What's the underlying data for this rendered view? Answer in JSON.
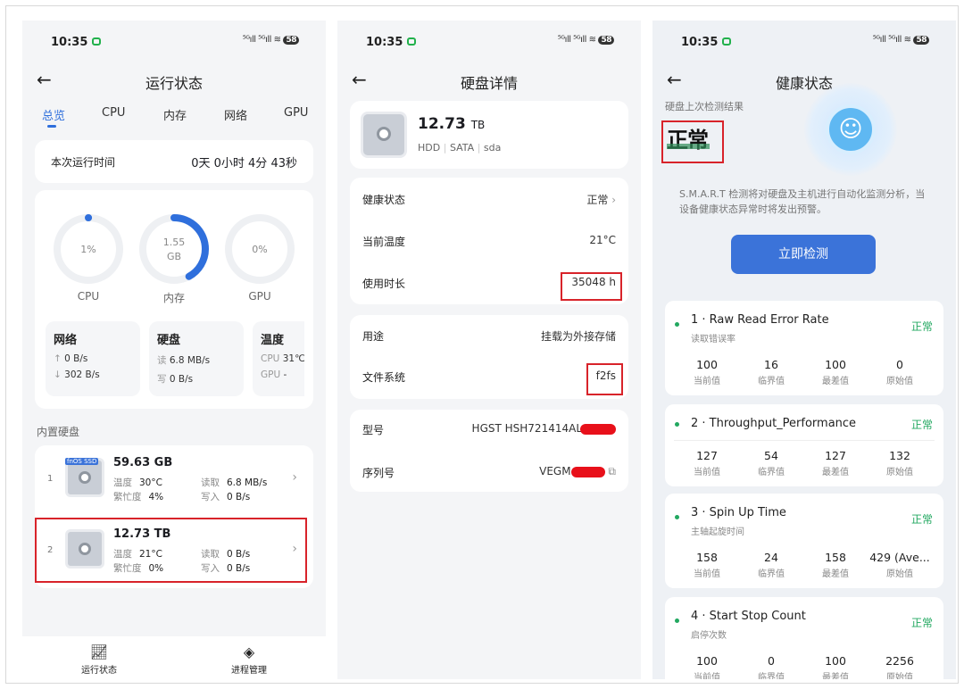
{
  "status": {
    "time": "10:35",
    "signal": "⁵ᴳıll ⁵ᴳıll ≋",
    "battery": "58"
  },
  "colors": {
    "accent": "#2f6fdc",
    "ok_green": "#22a860",
    "highlight_red": "#d8232a",
    "button": "#3b73d9"
  },
  "panel1": {
    "title": "运行状态",
    "tabs": [
      "总览",
      "CPU",
      "内存",
      "网络",
      "GPU"
    ],
    "uptime": {
      "label": "本次运行时间",
      "value": "0天 0小时 4分 43秒"
    },
    "rings": [
      {
        "label": "CPU",
        "text": "1%",
        "fraction": 0.01
      },
      {
        "label": "内存",
        "text": "1.55",
        "text2": "GB",
        "fraction": 0.42
      },
      {
        "label": "GPU",
        "text": "0%",
        "fraction": 0
      }
    ],
    "mini": [
      {
        "title": "网络",
        "l1k": "↑",
        "l1v": "0 B/s",
        "l2k": "↓",
        "l2v": "302 B/s"
      },
      {
        "title": "硬盘",
        "l1k": "读",
        "l1v": "6.8 MB/s",
        "l2k": "写",
        "l2v": "0 B/s"
      },
      {
        "title": "温度",
        "l1k": "CPU",
        "l1v": "31℃",
        "l2k": "GPU",
        "l2v": "-"
      }
    ],
    "disks_title": "内置硬盘",
    "disks": [
      {
        "num": "1",
        "size": "59.63 GB",
        "badge": "fnOS SSD",
        "temp_k": "温度",
        "temp": "30°C",
        "busy_k": "繁忙度",
        "busy": "4%",
        "read_k": "读取",
        "read": "6.8 MB/s",
        "write_k": "写入",
        "write": "0 B/s"
      },
      {
        "num": "2",
        "size": "12.73 TB",
        "temp_k": "温度",
        "temp": "21°C",
        "busy_k": "繁忙度",
        "busy": "0%",
        "read_k": "读取",
        "read": "0 B/s",
        "write_k": "写入",
        "write": "0 B/s"
      }
    ],
    "nav": [
      "运行状态",
      "进程管理"
    ]
  },
  "panel2": {
    "title": "硬盘详情",
    "size_num": "12.73",
    "size_unit": "TB",
    "type": "HDD",
    "iface": "SATA",
    "dev": "sda",
    "health_label": "健康状态",
    "health_value": "正常",
    "temp_label": "当前温度",
    "temp_value": "21°C",
    "hours_label": "使用时长",
    "hours_value": "35048 h",
    "use_label": "用途",
    "use_value": "挂载为外接存储",
    "fs_label": "文件系统",
    "fs_value": "f2fs",
    "model_label": "型号",
    "model_value": "HGST HSH721414AL",
    "serial_label": "序列号",
    "serial_value": "VEGM"
  },
  "panel3": {
    "title": "健康状态",
    "last_check_label": "硬盘上次检测结果",
    "result": "正常",
    "desc": "S.M.A.R.T 检测将对硬盘及主机进行自动化监测分析，当设备健康状态异常时将发出预警。",
    "button": "立即检测",
    "col_labels": [
      "当前值",
      "临界值",
      "最差值",
      "原始值"
    ],
    "attrs": [
      {
        "name": "1 · Raw Read Error Rate",
        "sub": "读取错误率",
        "status": "正常",
        "vals": [
          "100",
          "16",
          "100",
          "0"
        ]
      },
      {
        "name": "2 · Throughput_Performance",
        "sub": "",
        "status": "正常",
        "vals": [
          "127",
          "54",
          "127",
          "132"
        ]
      },
      {
        "name": "3 · Spin Up Time",
        "sub": "主轴起旋时间",
        "status": "正常",
        "vals": [
          "158",
          "24",
          "158",
          "429 (Ave..."
        ]
      },
      {
        "name": "4 · Start Stop Count",
        "sub": "启停次数",
        "status": "正常",
        "vals": [
          "100",
          "0",
          "100",
          "2256"
        ]
      }
    ]
  }
}
